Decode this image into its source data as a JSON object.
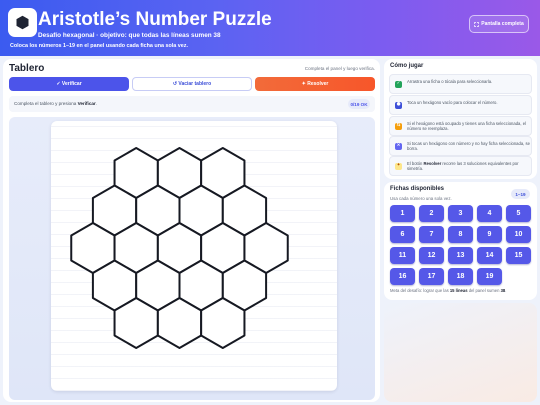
{
  "header": {
    "title": "Aristotle’s Number Puzzle",
    "subtitle": "Desafío hexagonal · objetivo: que todas las líneas sumen 38",
    "instructions": "Coloca los números 1–19 en el panel usando cada ficha una sola vez.",
    "fullscreen_label": "Pantalla completa",
    "logo_icon": "hexagon-icon",
    "colors": {
      "gradient_start": "#3b5bf0",
      "gradient_end": "#9a59e8"
    }
  },
  "board": {
    "title": "Tablero",
    "hint": "Completa el panel y luego verifica.",
    "verify_label": "✓ Verificar",
    "clear_label": "↺ Vaciar tablero",
    "solve_label": "✦ Resolver",
    "status_prefix": "Completa el tablero y presiona ",
    "status_strong": "Verificar",
    "status_suffix": ".",
    "filled_count": "0/19 OK",
    "colors": {
      "accent": "#4c54ea",
      "solve": "#f7562a"
    }
  },
  "howto": {
    "title": "Cómo jugar",
    "items": [
      {
        "icon": "drag-icon",
        "color": "#22a35a",
        "glyph": "✓",
        "pre": "Arrastra una ficha o tócala para seleccionarla.",
        "strong": "",
        "post": ""
      },
      {
        "icon": "tap-icon",
        "color": "#3d4fd8",
        "glyph": "●",
        "pre": "Toca un hexágono vacío para colocar el número.",
        "strong": "",
        "post": ""
      },
      {
        "icon": "swap-icon",
        "color": "#f59e0b",
        "glyph": "⇆",
        "pre": "Si el hexágono está ocupado y tienes una ficha seleccionada, el número se reemplaza.",
        "strong": "",
        "post": ""
      },
      {
        "icon": "erase-icon",
        "color": "#6366f1",
        "glyph": "×",
        "pre": "Si tocas un hexágono con número y no hay ficha seleccionada, se borra.",
        "strong": "",
        "post": ""
      },
      {
        "icon": "solve-icon",
        "color": "#fde68a",
        "glyph": "✦",
        "pre": "El botón ",
        "strong": "Resolver",
        "post": " recorre las 3 soluciones equivalentes por simetría."
      }
    ]
  },
  "tokens": {
    "title": "Fichas disponibles",
    "subtitle": "Usa cada número una sola vez.",
    "range": "1–19",
    "values": [
      "1",
      "2",
      "3",
      "4",
      "5",
      "6",
      "7",
      "8",
      "9",
      "10",
      "11",
      "12",
      "13",
      "14",
      "15",
      "16",
      "17",
      "18",
      "19"
    ],
    "goal_prefix": "Meta del desafío: lograr que las ",
    "goal_strong1": "15 líneas",
    "goal_middle": " del panel sumen ",
    "goal_strong2": "38",
    "goal_suffix": ".",
    "colors": {
      "token": "#5558e8"
    }
  }
}
